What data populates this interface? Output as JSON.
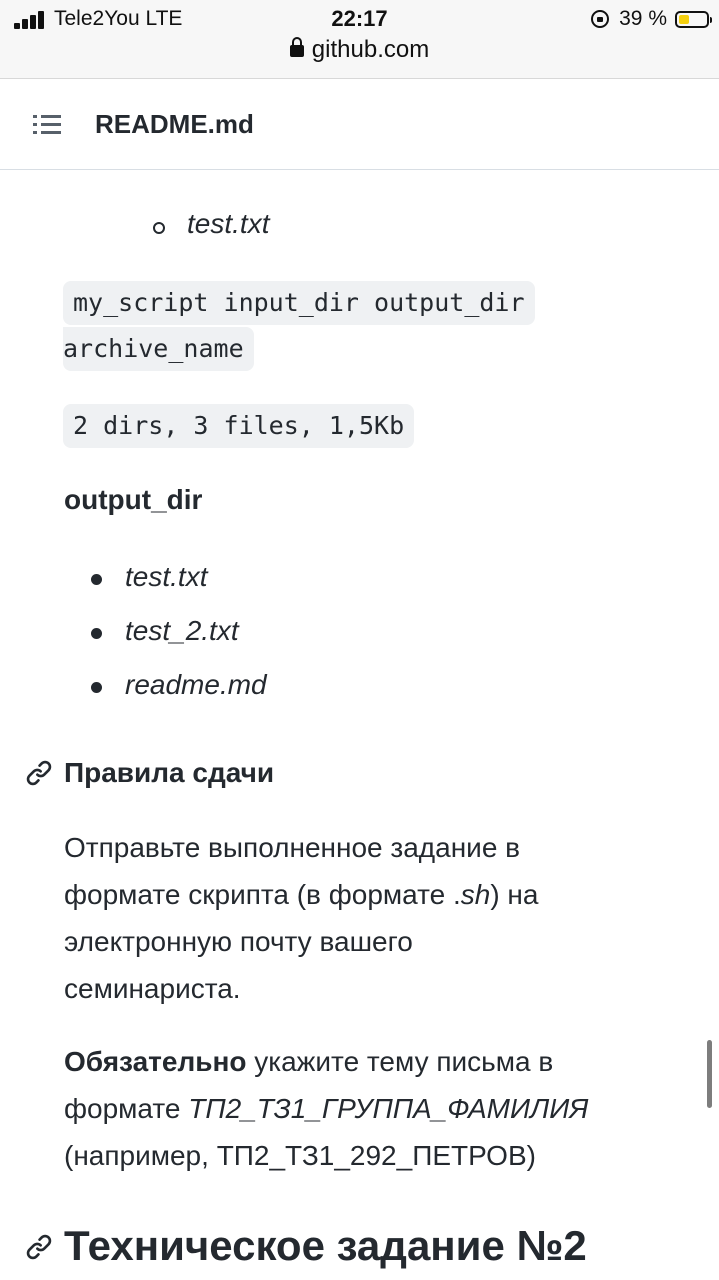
{
  "status_bar": {
    "carrier": "Tele2You  LTE",
    "time": "22:17",
    "url": "github.com",
    "battery": "39 %",
    "battery_level": 0.39
  },
  "file_header": {
    "filename": "README.md"
  },
  "content": {
    "nested_item": "test.txt",
    "code_command_line1": "my_script input_dir output_dir",
    "code_command_line2": "archive_name",
    "code_summary": "2 dirs, 3 files, 1,5Kb",
    "output_heading": "output_dir",
    "output_files": [
      "test.txt",
      "test_2.txt",
      "readme.md"
    ],
    "rules_heading": "Правила сдачи",
    "para1": {
      "line1": "Отправьте выполненное задание в",
      "line2_before": "формате скрипта (в формате .",
      "line2_italic": "sh",
      "line2_after": ") на",
      "line3": "электронную почту вашего",
      "line4": "семинариста."
    },
    "para2": {
      "bold": "Обязательно",
      "line1_rest": " укажите тему письма в",
      "line2_before": "формате ",
      "line2_italic": "ТП2_ТЗ1_ГРУППА_ФАМИЛИЯ",
      "line3": "(например, ТП2_ТЗ1_292_ПЕТРОВ)"
    },
    "section_heading": "Техническое задание №2"
  }
}
